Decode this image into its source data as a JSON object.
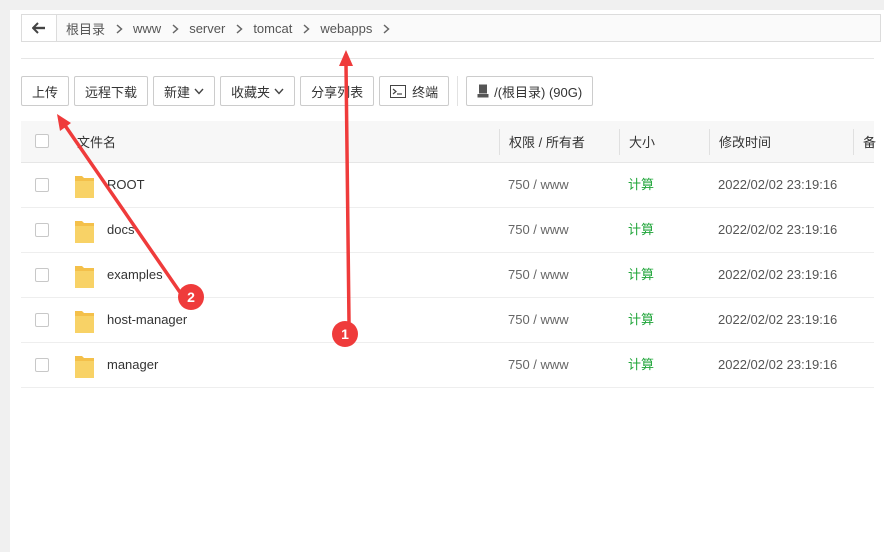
{
  "breadcrumb": {
    "items": [
      "根目录",
      "www",
      "server",
      "tomcat",
      "webapps"
    ]
  },
  "toolbar": {
    "upload": "上传",
    "remote_download": "远程下载",
    "new": "新建",
    "favorites": "收藏夹",
    "share_list": "分享列表",
    "terminal": "终端",
    "disk": "/(根目录) (90G)"
  },
  "table": {
    "headers": {
      "name": "文件名",
      "perm": "权限 / 所有者",
      "size": "大小",
      "mtime": "修改时间",
      "extra": "备"
    },
    "rows": [
      {
        "name": "ROOT",
        "perm": "750 / www",
        "size": "计算",
        "mtime": "2022/02/02 23:19:16"
      },
      {
        "name": "docs",
        "perm": "750 / www",
        "size": "计算",
        "mtime": "2022/02/02 23:19:16"
      },
      {
        "name": "examples",
        "perm": "750 / www",
        "size": "计算",
        "mtime": "2022/02/02 23:19:16"
      },
      {
        "name": "host-manager",
        "perm": "750 / www",
        "size": "计算",
        "mtime": "2022/02/02 23:19:16"
      },
      {
        "name": "manager",
        "perm": "750 / www",
        "size": "计算",
        "mtime": "2022/02/02 23:19:16"
      }
    ]
  },
  "annotations": {
    "marker1": "1",
    "marker2": "2",
    "color": "#ef3b3b"
  },
  "colors": {
    "accent_green": "#20a53a",
    "folder_yellow": "#f6c343"
  }
}
